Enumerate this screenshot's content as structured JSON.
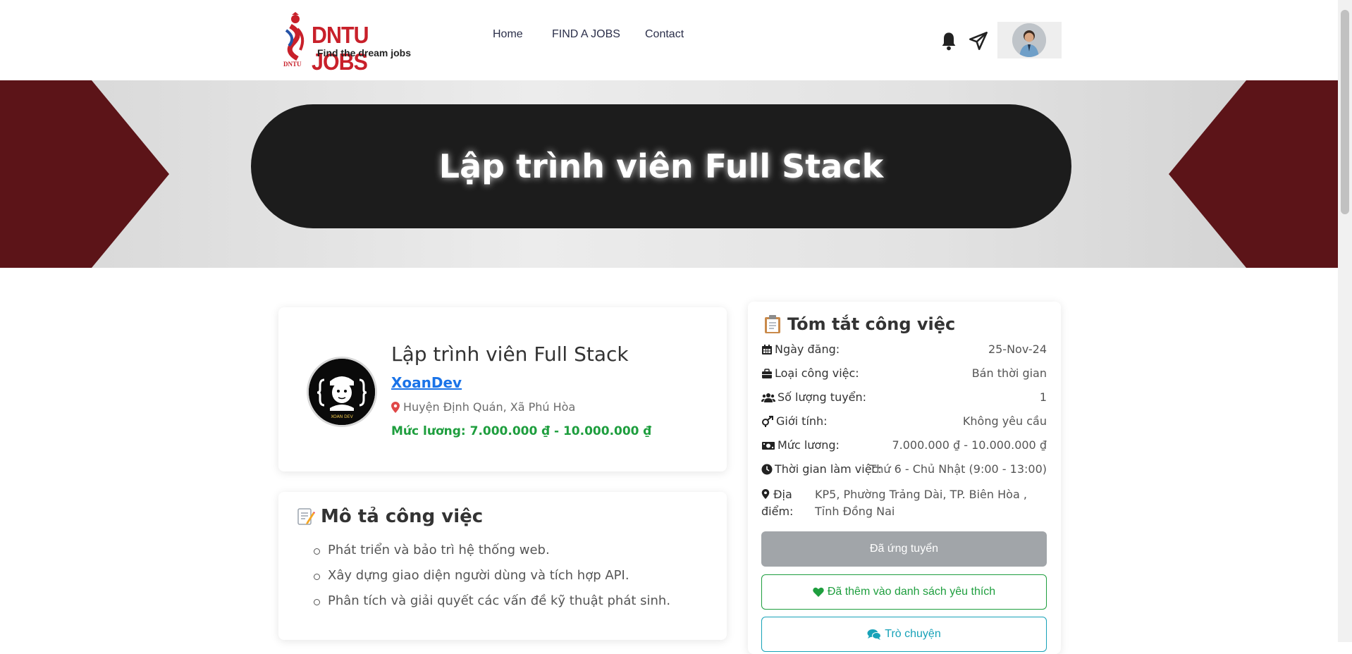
{
  "brand": {
    "title": "DNTU JOBS",
    "tagline": "Find the dream jobs",
    "mark_text": "DNTU",
    "color": "#c8202a"
  },
  "nav": {
    "home": "Home",
    "find_jobs": "FIND A JOBS",
    "contact": "Contact"
  },
  "header_icons": [
    "bell-icon",
    "paper-plane-icon",
    "user-avatar"
  ],
  "hero": {
    "title": "Lập trình viên Full Stack"
  },
  "job": {
    "title": "Lập trình viên Full Stack",
    "company": "XoanDev",
    "company_logo_text": "XOAN DEV",
    "location": "Huyện Định Quán, Xã Phú Hòa",
    "salary": "Mức lương: 7.000.000 ₫ - 10.000.000 ₫"
  },
  "description": {
    "heading": "Mô tả công việc",
    "items": [
      "Phát triển và bảo trì hệ thống web.",
      "Xây dựng giao diện người dùng và tích hợp API.",
      "Phân tích và giải quyết các vấn đề kỹ thuật phát sinh."
    ]
  },
  "summary": {
    "heading": "Tóm tắt công việc",
    "rows": {
      "posted": {
        "label": "Ngày đăng:",
        "value": "25-Nov-24"
      },
      "type": {
        "label": "Loại công việc:",
        "value": "Bán thời gian"
      },
      "quantity": {
        "label": "Số lượng tuyển:",
        "value": "1"
      },
      "gender": {
        "label": "Giới tính:",
        "value": "Không yêu cầu"
      },
      "salary": {
        "label": "Mức lương:",
        "value": "7.000.000 ₫ - 10.000.000 ₫"
      },
      "hours": {
        "label": "Thời gian làm việc:",
        "value": "Thứ 6 - Chủ Nhật (9:00 - 13:00)"
      },
      "address": {
        "label": "Địa điểm:",
        "value": "KP5, Phường Trảng Dài, TP. Biên Hòa , Tỉnh Đồng Nai"
      }
    },
    "buttons": {
      "applied": "Đã ứng tuyển",
      "favorite": "Đã thêm vào danh sách yêu thích",
      "chat": "Trò chuyện"
    }
  },
  "colors": {
    "hero_pill": "#1c1c1c",
    "hero_side": "#5c1418",
    "accent_green": "#1e9e3e",
    "accent_blue": "#1a73e8",
    "accent_teal": "#17a2b8"
  }
}
